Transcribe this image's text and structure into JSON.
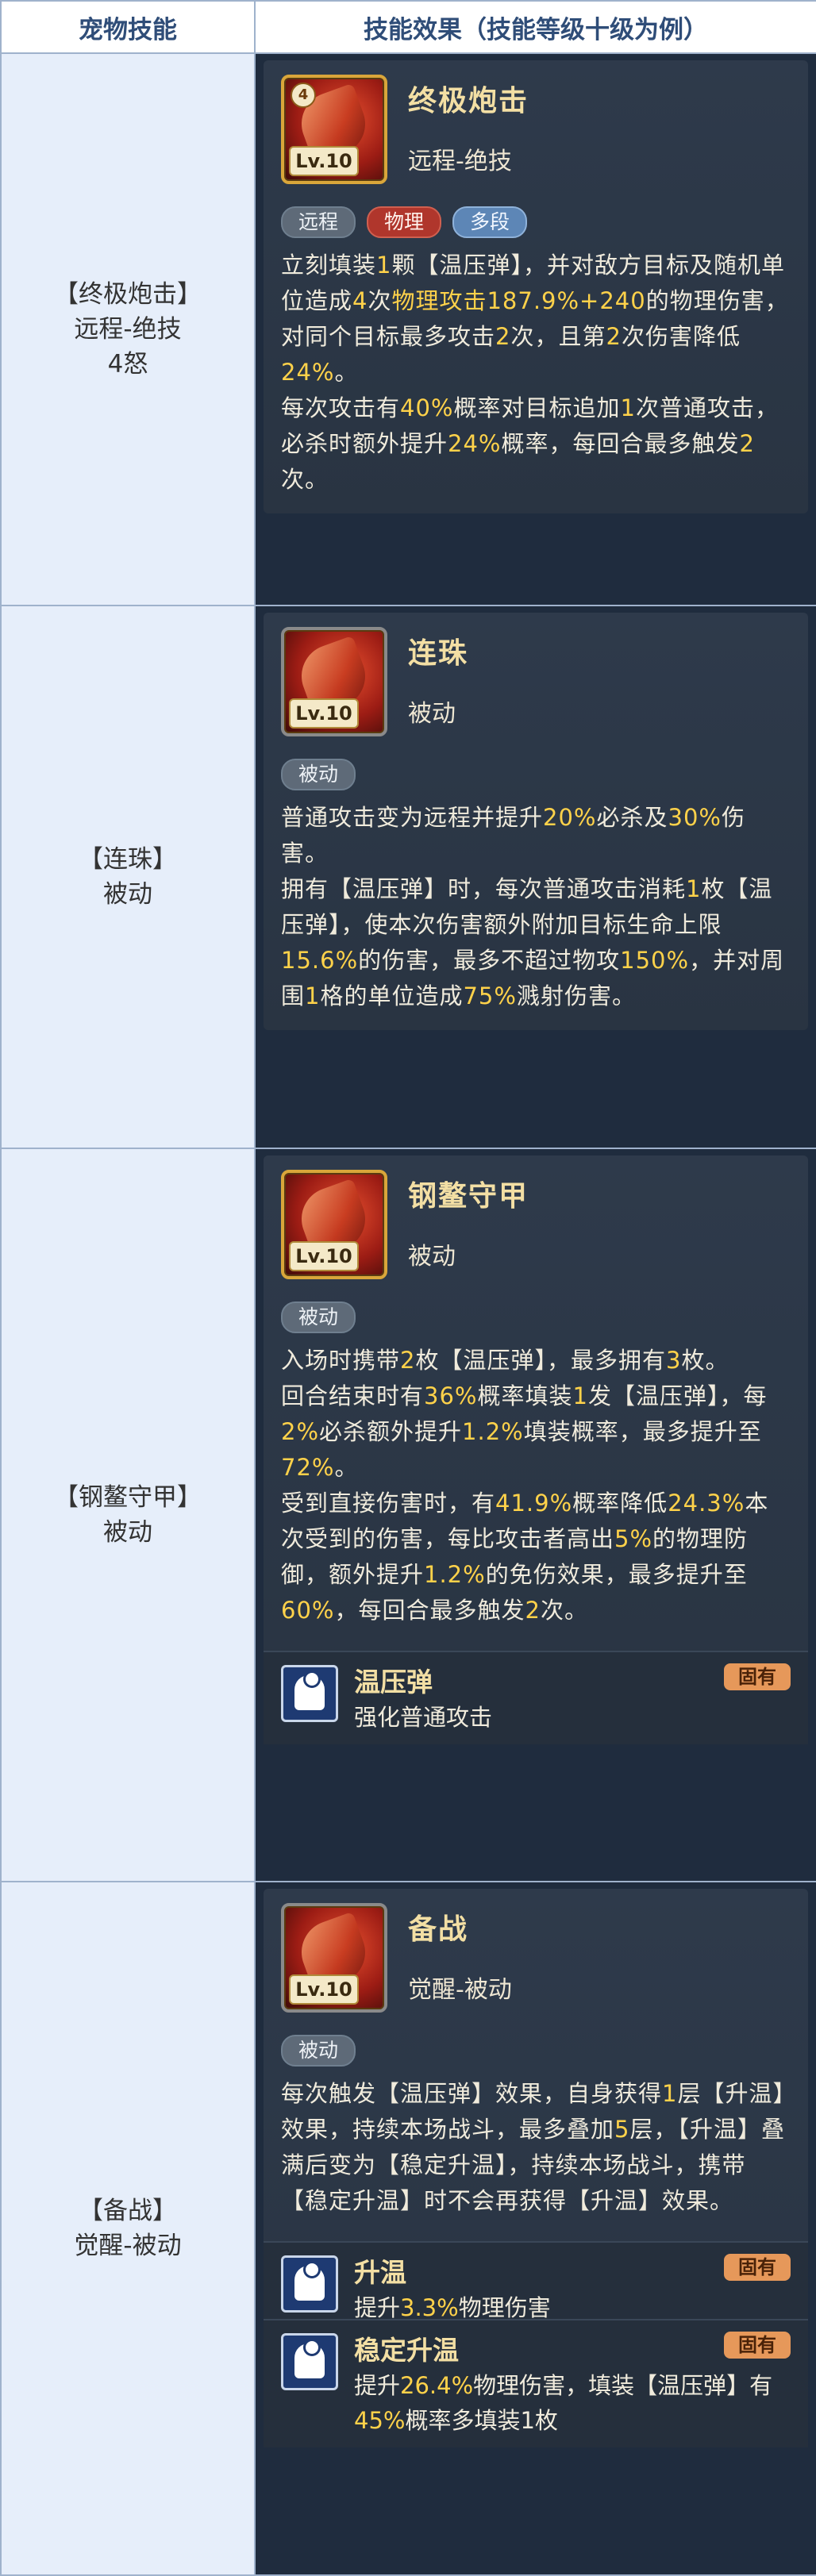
{
  "header": {
    "col1": "宠物技能",
    "col2": "技能效果（技能等级十级为例）"
  },
  "skills": [
    {
      "name": "终极炮击",
      "type": "远程-绝技",
      "left_name": "【终极炮击】",
      "left_type": "远程-绝技",
      "left_extra": "4怒",
      "level": "Lv.10",
      "rank": "4",
      "tags": [
        "远程",
        "物理",
        "多段"
      ],
      "desc": [
        {
          "t": "立刻填装"
        },
        {
          "t": "1",
          "h": 1
        },
        {
          "t": "颗【温压弹】，并对敌方目标及随机单位造成"
        },
        {
          "t": "4",
          "h": 1
        },
        {
          "t": "次"
        },
        {
          "t": "物理攻击187.9%+240",
          "h": 1
        },
        {
          "t": "的物理伤害，对同个目标最多攻击"
        },
        {
          "t": "2",
          "h": 1
        },
        {
          "t": "次，且第"
        },
        {
          "t": "2",
          "h": 1
        },
        {
          "t": "次伤害降低"
        },
        {
          "t": "24%",
          "h": 1
        },
        {
          "t": "。"
        },
        {
          "br": 1
        },
        {
          "t": "每次攻击有"
        },
        {
          "t": "40%",
          "h": 1
        },
        {
          "t": "概率对目标追加"
        },
        {
          "t": "1",
          "h": 1
        },
        {
          "t": "次普通攻击，必杀时额外提升"
        },
        {
          "t": "24%",
          "h": 1
        },
        {
          "t": "概率，每回合最多触发"
        },
        {
          "t": "2",
          "h": 1
        },
        {
          "t": "次。"
        }
      ]
    },
    {
      "name": "连珠",
      "type": "被动",
      "left_name": "【连珠】",
      "left_type": "被动",
      "level": "Lv.10",
      "tags": [
        "被动"
      ],
      "desc": [
        {
          "t": "普通攻击变为远程并提升"
        },
        {
          "t": "20%",
          "h": 1
        },
        {
          "t": "必杀及"
        },
        {
          "t": "30%",
          "h": 1
        },
        {
          "t": "伤害。"
        },
        {
          "br": 1
        },
        {
          "t": "拥有【温压弹】时，每次普通攻击消耗"
        },
        {
          "t": "1",
          "h": 1
        },
        {
          "t": "枚【温压弹】，使本次伤害额外附加目标生命上限"
        },
        {
          "t": "15.6%",
          "h": 1
        },
        {
          "t": "的伤害，最多不超过物攻"
        },
        {
          "t": "150%",
          "h": 1
        },
        {
          "t": "，并对周围"
        },
        {
          "t": "1",
          "h": 1
        },
        {
          "t": "格的单位造成"
        },
        {
          "t": "75%",
          "h": 1
        },
        {
          "t": "溅射伤害。"
        }
      ]
    },
    {
      "name": "钢鳌守甲",
      "type": "被动",
      "left_name": "【钢鳌守甲】",
      "left_type": "被动",
      "level": "Lv.10",
      "tags": [
        "被动"
      ],
      "desc": [
        {
          "t": "入场时携带"
        },
        {
          "t": "2",
          "h": 1
        },
        {
          "t": "枚【温压弹】，最多拥有"
        },
        {
          "t": "3",
          "h": 1
        },
        {
          "t": "枚。"
        },
        {
          "br": 1
        },
        {
          "t": "回合结束时有"
        },
        {
          "t": "36%",
          "h": 1
        },
        {
          "t": "概率填装"
        },
        {
          "t": "1",
          "h": 1
        },
        {
          "t": "发【温压弹】，每"
        },
        {
          "t": "2%",
          "h": 1
        },
        {
          "t": "必杀额外提升"
        },
        {
          "t": "1.2%",
          "h": 1
        },
        {
          "t": "填装概率，最多提升至"
        },
        {
          "t": "72%",
          "h": 1
        },
        {
          "t": "。"
        },
        {
          "br": 1
        },
        {
          "t": "受到直接伤害时，有"
        },
        {
          "t": "41.9%",
          "h": 1
        },
        {
          "t": "概率降低"
        },
        {
          "t": "24.3%",
          "h": 1
        },
        {
          "t": "本次受到的伤害，每比攻击者高出"
        },
        {
          "t": "5%",
          "h": 1
        },
        {
          "t": "的物理防御，额外提升"
        },
        {
          "t": "1.2%",
          "h": 1
        },
        {
          "t": "的免伤效果，最多提升至"
        },
        {
          "t": "60%",
          "h": 1
        },
        {
          "t": "，每回合最多触发"
        },
        {
          "t": "2",
          "h": 1
        },
        {
          "t": "次。"
        }
      ],
      "traits": [
        {
          "name": "温压弹",
          "desc": "强化普通攻击",
          "badge": "固有"
        }
      ]
    },
    {
      "name": "备战",
      "type": "觉醒-被动",
      "left_name": "【备战】",
      "left_type": "觉醒-被动",
      "level": "Lv.10",
      "tags": [
        "被动"
      ],
      "desc": [
        {
          "t": "每次触发【温压弹】效果，自身获得"
        },
        {
          "t": "1",
          "h": 1
        },
        {
          "t": "层【升温】效果，持续本场战斗，最多叠加"
        },
        {
          "t": "5",
          "h": 1
        },
        {
          "t": "层，【升温】叠满后变为【稳定升温】，持续本场战斗，携带【稳定升温】时不会再获得【升温】效果。"
        }
      ],
      "traits": [
        {
          "name": "升温",
          "desc": [
            {
              "t": "提升"
            },
            {
              "t": "3.3%",
              "h": 1
            },
            {
              "t": "物理伤害"
            }
          ],
          "badge": "固有"
        },
        {
          "name": "稳定升温",
          "desc": [
            {
              "t": "提升"
            },
            {
              "t": "26.4%",
              "h": 1
            },
            {
              "t": "物理伤害，填装【温压弹】有"
            },
            {
              "t": "45%",
              "h": 1
            },
            {
              "t": "概率多填装1枚"
            }
          ],
          "badge": "固有"
        }
      ]
    }
  ]
}
